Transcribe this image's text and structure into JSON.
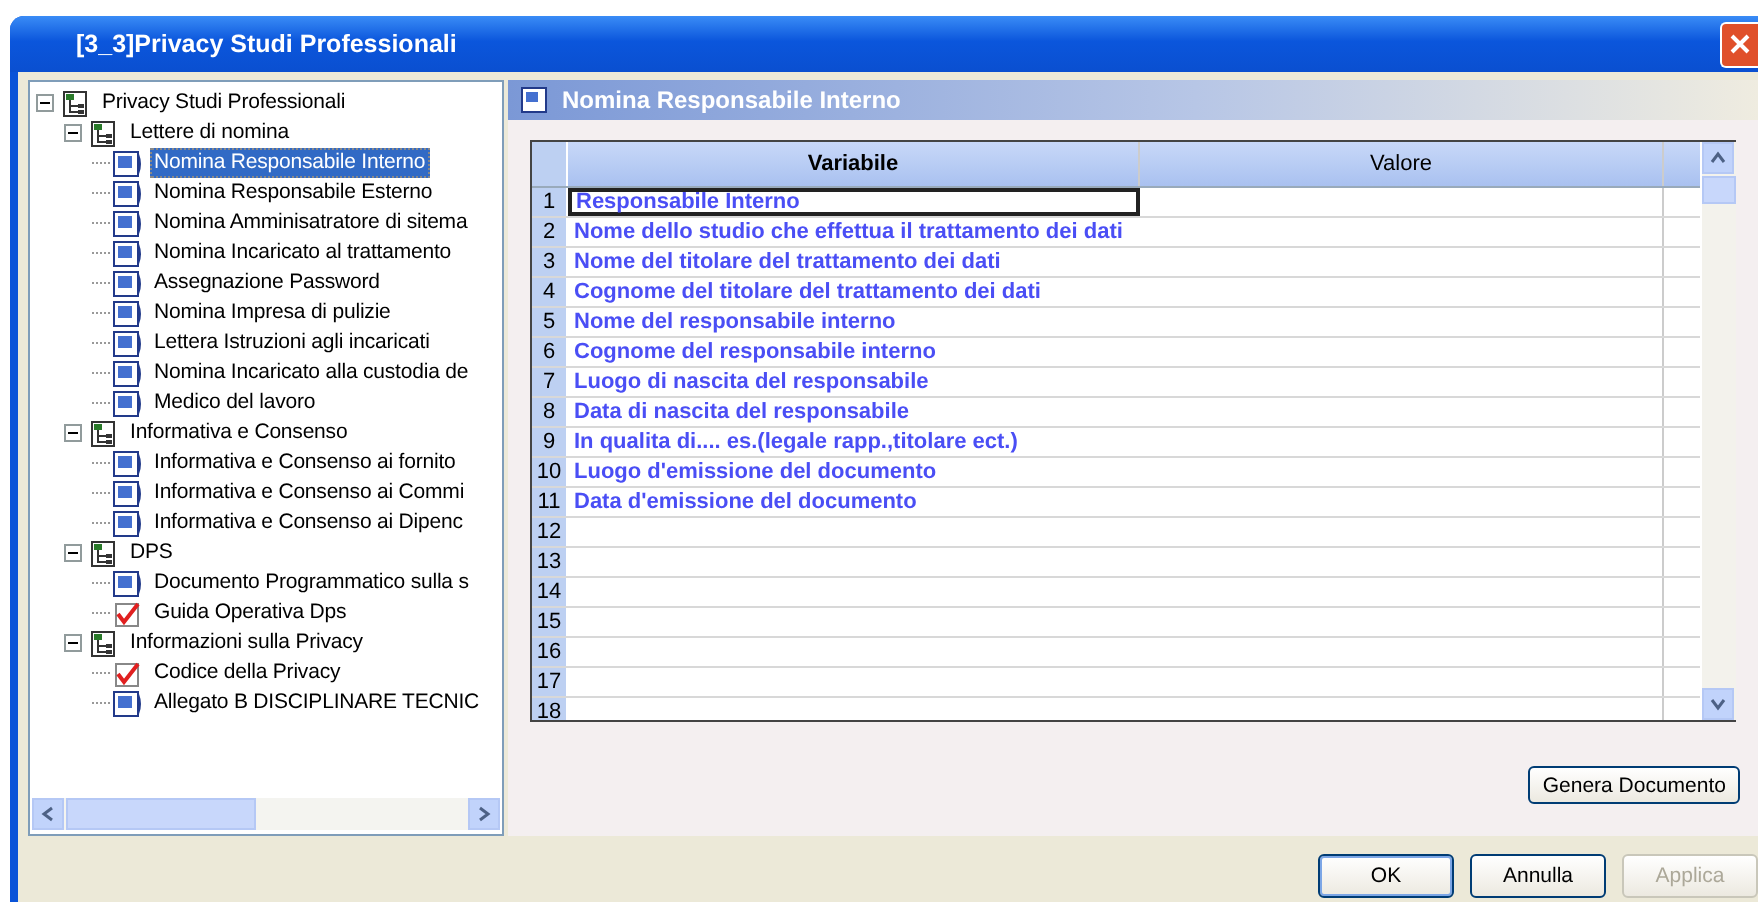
{
  "window": {
    "title": "[3_3]Privacy Studi Professionali"
  },
  "tree": [
    {
      "label": "Privacy Studi Professionali",
      "kind": "folder",
      "expanded": true,
      "selected": false,
      "children": [
        {
          "label": "Lettere di nomina",
          "kind": "folder",
          "expanded": true,
          "selected": false,
          "children": [
            {
              "label": "Nomina Responsabile Interno",
              "kind": "document",
              "selected": true
            },
            {
              "label": "Nomina Responsabile Esterno",
              "kind": "document",
              "selected": false
            },
            {
              "label": "Nomina Amminisatratore di sitema",
              "kind": "document",
              "selected": false
            },
            {
              "label": "Nomina Incaricato al trattamento",
              "kind": "document",
              "selected": false
            },
            {
              "label": "Assegnazione Password",
              "kind": "document",
              "selected": false
            },
            {
              "label": "Nomina Impresa di pulizie",
              "kind": "document",
              "selected": false
            },
            {
              "label": "Lettera Istruzioni agli incaricati",
              "kind": "document",
              "selected": false
            },
            {
              "label": "Nomina Incaricato alla custodia de",
              "kind": "document",
              "selected": false
            },
            {
              "label": "Medico del lavoro",
              "kind": "document",
              "selected": false
            }
          ]
        },
        {
          "label": "Informativa e Consenso",
          "kind": "folder",
          "expanded": true,
          "selected": false,
          "children": [
            {
              "label": "Informativa e Consenso ai fornito",
              "kind": "document",
              "selected": false
            },
            {
              "label": "Informativa e Consenso ai Commi",
              "kind": "document",
              "selected": false
            },
            {
              "label": "Informativa e Consenso ai Dipenc",
              "kind": "document",
              "selected": false
            }
          ]
        },
        {
          "label": "DPS",
          "kind": "folder",
          "expanded": true,
          "selected": false,
          "children": [
            {
              "label": "Documento Programmatico sulla s",
              "kind": "document",
              "selected": false
            },
            {
              "label": "Guida Operativa Dps",
              "kind": "checklist",
              "selected": false
            }
          ]
        },
        {
          "label": "Informazioni sulla Privacy",
          "kind": "folder",
          "expanded": true,
          "selected": false,
          "children": [
            {
              "label": "Codice della Privacy",
              "kind": "checklist",
              "selected": false
            },
            {
              "label": "Allegato B DISCIPLINARE TECNIC",
              "kind": "document",
              "selected": false
            }
          ]
        }
      ]
    }
  ],
  "panel": {
    "title": "Nomina Responsabile Interno"
  },
  "table": {
    "columns": [
      "Variabile",
      "Valore"
    ],
    "rows": [
      {
        "number": "1",
        "variabile": "Responsabile Interno",
        "selected": true
      },
      {
        "number": "2",
        "variabile": "Nome dello studio che effettua il trattamento dei dati",
        "selected": false
      },
      {
        "number": "3",
        "variabile": "Nome del titolare del trattamento dei dati",
        "selected": false
      },
      {
        "number": "4",
        "variabile": "Cognome del titolare del trattamento dei dati",
        "selected": false
      },
      {
        "number": "5",
        "variabile": "Nome del responsabile interno",
        "selected": false
      },
      {
        "number": "6",
        "variabile": "Cognome del responsabile interno",
        "selected": false
      },
      {
        "number": "7",
        "variabile": "Luogo di nascita del responsabile",
        "selected": false
      },
      {
        "number": "8",
        "variabile": "Data di nascita del responsabile",
        "selected": false
      },
      {
        "number": "9",
        "variabile": "In qualita di.... es.(legale rapp.,titolare ect.)",
        "selected": false
      },
      {
        "number": "10",
        "variabile": "Luogo d'emissione del documento",
        "selected": false
      },
      {
        "number": "11",
        "variabile": "Data d'emissione del documento",
        "selected": false
      },
      {
        "number": "12",
        "selected": false
      },
      {
        "number": "13",
        "selected": false
      },
      {
        "number": "14",
        "selected": false
      },
      {
        "number": "15",
        "selected": false
      },
      {
        "number": "16",
        "selected": false
      },
      {
        "number": "17",
        "selected": false
      },
      {
        "number": "18",
        "selected": false
      }
    ]
  },
  "generate_button": {
    "label": "Genera Documento"
  },
  "buttons": [
    {
      "label": "OK",
      "disabled": false,
      "default": true
    },
    {
      "label": "Annulla",
      "disabled": false,
      "default": false
    },
    {
      "label": "Applica",
      "disabled": true,
      "default": false
    }
  ]
}
